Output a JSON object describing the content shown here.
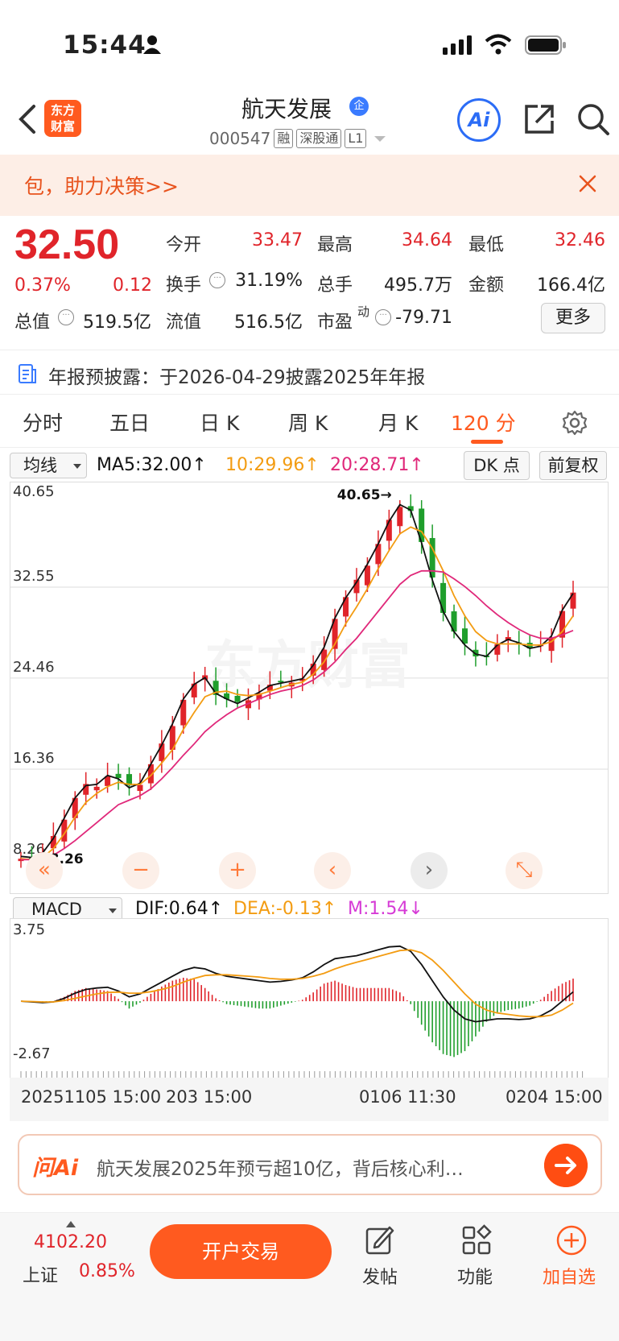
{
  "status_bar": {
    "time": "15:44"
  },
  "header": {
    "logo_line1": "东方",
    "logo_line2": "财富",
    "stock_name": "航天发展",
    "enterprise_badge": "企",
    "stock_code": "000547",
    "tags": [
      "融",
      "深股通",
      "L1"
    ],
    "ai_label": "Ai"
  },
  "banner": {
    "text": "包，助力决策>>"
  },
  "quote": {
    "price": "32.50",
    "change_pct": "0.37%",
    "change_amt": "0.12",
    "rows": [
      [
        {
          "label": "今开",
          "value": "33.47",
          "red": true
        },
        {
          "label": "最高",
          "value": "34.64",
          "red": true
        },
        {
          "label": "最低",
          "value": "32.46",
          "red": true
        }
      ],
      [
        {
          "label": "换手",
          "value": "31.19%",
          "red": false
        },
        {
          "label": "总手",
          "value": "495.7万",
          "red": false
        },
        {
          "label": "金额",
          "value": "166.4亿",
          "red": false
        }
      ]
    ],
    "total_value_label": "总值",
    "total_value": "519.5亿",
    "float_value_label": "流值",
    "float_value": "516.5亿",
    "pe_label": "市盈",
    "pe_sup": "动",
    "pe_value": "-79.71",
    "more_label": "更多"
  },
  "notice": {
    "text": "年报预披露：于2026-04-29披露2025年年报"
  },
  "tabs": [
    "分时",
    "五日",
    "日 K",
    "周 K",
    "月 K",
    "120 分"
  ],
  "active_tab": 5,
  "ma_row": {
    "selector": "均线",
    "ma5": "MA5:32.00↑",
    "ma10": "10:29.96↑",
    "ma20": "20:28.71↑",
    "dk_label": "DK 点",
    "fq_label": "前复权"
  },
  "macd_row": {
    "selector": "MACD",
    "dif": "DIF:0.64↑",
    "dea": "DEA:-0.13↑",
    "m": "M:1.54↓"
  },
  "colors": {
    "up": "#e0242a",
    "down": "#1f9e2c",
    "ma5": "#111111",
    "ma10": "#f39c12",
    "ma20": "#e0287a",
    "accent": "#ff5a1f"
  },
  "chart_data": [
    {
      "type": "line",
      "title": "",
      "y_ticks": [
        "40.65",
        "32.55",
        "24.46",
        "16.36",
        "8.26"
      ],
      "ylim": [
        8.26,
        40.65
      ],
      "high_marker": "40.65",
      "low_marker": "8.26",
      "series": [
        {
          "name": "MA5",
          "values": [
            8.6,
            8.5,
            8.9,
            10.2,
            12.0,
            13.8,
            14.9,
            15.0,
            15.8,
            15.5,
            14.7,
            15.1,
            16.8,
            18.5,
            20.4,
            22.6,
            23.9,
            24.5,
            23.1,
            22.6,
            22.2,
            22.7,
            23.2,
            23.8,
            24.0,
            24.2,
            24.4,
            25.6,
            27.2,
            29.8,
            31.6,
            33.0,
            34.6,
            36.4,
            38.4,
            39.9,
            39.4,
            36.5,
            33.2,
            30.4,
            28.6,
            27.4,
            26.6,
            26.4,
            27.4,
            27.9,
            27.6,
            27.1,
            27.3,
            28.2,
            30.5,
            32.0
          ]
        },
        {
          "name": "10",
          "values": [
            8.4,
            8.3,
            8.5,
            9.3,
            10.6,
            12.1,
            13.4,
            14.2,
            14.8,
            15.2,
            15.0,
            15.0,
            15.8,
            16.9,
            18.1,
            19.9,
            21.4,
            22.8,
            23.2,
            23.3,
            23.0,
            22.9,
            23.0,
            23.3,
            23.6,
            23.9,
            24.1,
            24.8,
            25.9,
            27.5,
            29.3,
            30.8,
            32.4,
            34.2,
            35.8,
            37.3,
            37.9,
            37.5,
            36.0,
            34.0,
            31.8,
            30.0,
            28.6,
            27.8,
            27.5,
            27.5,
            27.5,
            27.4,
            27.4,
            27.7,
            28.6,
            30.0
          ]
        },
        {
          "name": "20",
          "values": [
            8.3,
            8.3,
            8.4,
            8.7,
            9.3,
            10.0,
            10.8,
            11.6,
            12.4,
            13.2,
            13.6,
            14.0,
            14.6,
            15.5,
            16.5,
            17.6,
            18.6,
            19.7,
            20.5,
            21.2,
            21.8,
            22.2,
            22.6,
            23.0,
            23.3,
            23.5,
            23.8,
            24.3,
            25.0,
            25.9,
            27.0,
            28.0,
            29.2,
            30.4,
            31.6,
            32.8,
            33.6,
            34.0,
            34.0,
            33.9,
            33.3,
            32.6,
            31.8,
            30.9,
            30.1,
            29.4,
            28.8,
            28.3,
            28.0,
            28.0,
            28.3,
            28.7
          ]
        }
      ]
    },
    {
      "type": "bar",
      "title": "MACD",
      "y_ticks": [
        "3.75",
        "-2.67"
      ],
      "ylim": [
        -2.67,
        3.75
      ],
      "x_ticks": [
        "20251105 15:00",
        "203 15:00",
        "0106 11:30",
        "0204 15:00"
      ],
      "series": [
        {
          "name": "DIF",
          "values": [
            0.0,
            -0.05,
            -0.1,
            -0.05,
            0.2,
            0.55,
            0.8,
            0.9,
            0.95,
            0.7,
            0.3,
            0.5,
            0.9,
            1.3,
            1.7,
            2.1,
            2.3,
            2.2,
            1.9,
            1.7,
            1.6,
            1.5,
            1.4,
            1.3,
            1.35,
            1.45,
            1.6,
            2.0,
            2.5,
            2.9,
            3.0,
            3.1,
            3.3,
            3.5,
            3.7,
            3.75,
            3.4,
            2.5,
            1.4,
            0.3,
            -0.6,
            -1.2,
            -1.4,
            -1.3,
            -1.2,
            -1.2,
            -1.25,
            -1.2,
            -1.0,
            -0.6,
            0.0,
            0.64
          ]
        },
        {
          "name": "DEA",
          "values": [
            0.0,
            -0.02,
            -0.05,
            -0.05,
            0.05,
            0.2,
            0.35,
            0.5,
            0.6,
            0.62,
            0.55,
            0.55,
            0.65,
            0.8,
            1.0,
            1.3,
            1.55,
            1.75,
            1.8,
            1.8,
            1.75,
            1.7,
            1.65,
            1.55,
            1.5,
            1.5,
            1.55,
            1.7,
            1.9,
            2.2,
            2.45,
            2.65,
            2.85,
            3.05,
            3.25,
            3.45,
            3.5,
            3.3,
            2.8,
            2.1,
            1.3,
            0.5,
            -0.2,
            -0.6,
            -0.8,
            -0.9,
            -1.0,
            -1.05,
            -1.05,
            -0.95,
            -0.6,
            -0.13
          ]
        },
        {
          "name": "M",
          "values": [
            0.0,
            -0.06,
            -0.1,
            0.0,
            0.3,
            0.7,
            0.9,
            0.8,
            0.7,
            0.16,
            -0.5,
            -0.1,
            0.5,
            1.0,
            1.4,
            1.6,
            1.5,
            0.9,
            0.2,
            -0.2,
            -0.3,
            -0.4,
            -0.5,
            -0.5,
            -0.3,
            -0.1,
            0.1,
            0.6,
            1.2,
            1.4,
            1.1,
            0.9,
            0.9,
            0.9,
            0.9,
            0.6,
            -0.2,
            -1.6,
            -2.8,
            -3.6,
            -3.8,
            -3.4,
            -2.4,
            -1.4,
            -0.8,
            -0.6,
            -0.5,
            -0.3,
            0.1,
            0.7,
            1.2,
            1.54
          ]
        }
      ]
    }
  ],
  "chart_controls": [
    "«",
    "−",
    "+",
    "‹",
    "›",
    "⤡"
  ],
  "ask_bar": {
    "brand": "问Ai",
    "text": "航天发展2025年预亏超10亿，背后核心利…"
  },
  "bottom": {
    "index_value": "4102.20",
    "index_name": "上证",
    "index_pct": "0.85%",
    "trade_label": "开户交易",
    "post_label": "发帖",
    "func_label": "功能",
    "watch_label": "加自选"
  },
  "watermark": "东方财富"
}
